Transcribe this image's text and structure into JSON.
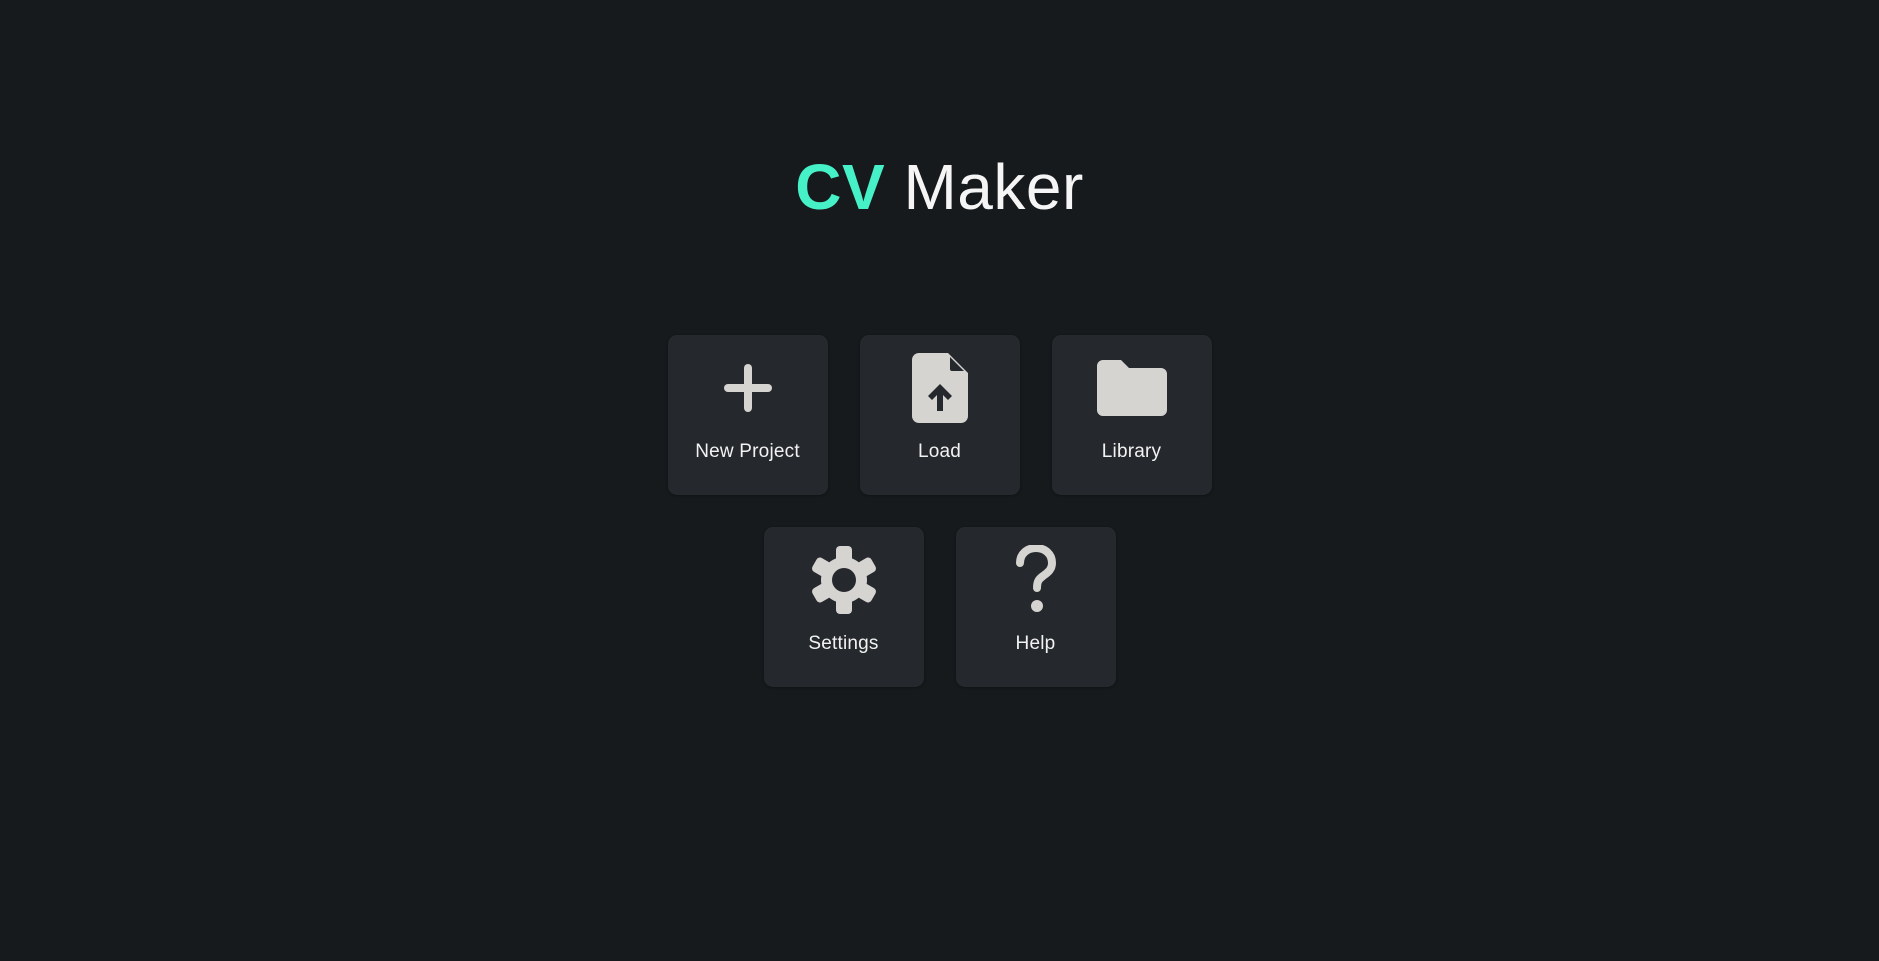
{
  "header": {
    "title_accent": "CV",
    "title_rest": "Maker"
  },
  "menu": {
    "new_project": {
      "label": "New Project",
      "icon": "plus-icon"
    },
    "load": {
      "label": "Load",
      "icon": "file-upload-icon"
    },
    "library": {
      "label": "Library",
      "icon": "folder-icon"
    },
    "settings": {
      "label": "Settings",
      "icon": "gear-icon"
    },
    "help": {
      "label": "Help",
      "icon": "question-mark-icon"
    }
  },
  "colors": {
    "background": "#171a1d",
    "tile": "#25282c",
    "accent": "#46f1c7",
    "icon": "#d6d4d0",
    "text": "#f2f2f2"
  }
}
